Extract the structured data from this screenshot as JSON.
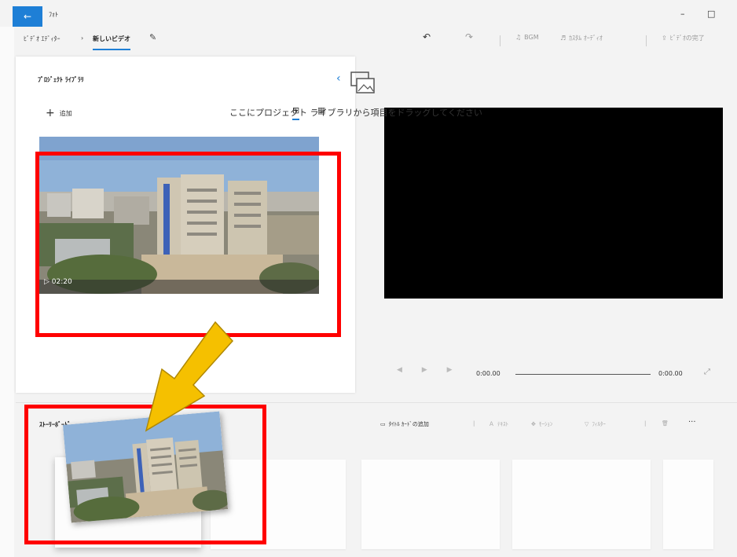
{
  "window": {
    "back_label": "←",
    "title": "ﾌｫﾄ",
    "minimize": "–",
    "maximize": "□"
  },
  "nav": {
    "breadcrumb_parent": "ﾋﾞﾃﾞｵ ｴﾃﾞｨﾀｰ",
    "breadcrumb_sep": "›",
    "breadcrumb_current": "新しいビデオ",
    "undo": "↶",
    "redo": "↷",
    "bgm": "BGM",
    "custom_audio": "ｶｽﾀﾑ ｵｰﾃﾞｨｵ",
    "finish_video": "ﾋﾞﾃﾞｵの完了"
  },
  "library": {
    "title": "ﾌﾟﾛｼﾞｪｸﾄ ﾗｲﾌﾞﾗﾘ",
    "add_label": "追加",
    "clip_duration": "02:20"
  },
  "player": {
    "current_time": "0:00.00",
    "total_time": "0:00.00"
  },
  "storyboard": {
    "title": "ｽﾄｰﾘｰﾎﾞｰﾄﾞ",
    "add_title_card": "ﾀｲﾄﾙ ｶｰﾄﾞの追加",
    "text": "ﾃｷｽﾄ",
    "motion": "ﾓｰｼｮﾝ",
    "filter": "ﾌｨﾙﾀｰ",
    "more": "···",
    "drop_hint": "ここにプロジェクト ライブラリから項目をドラッグしてください"
  },
  "colors": {
    "accent": "#1e7fd6",
    "annotation_red": "#ff0000",
    "arrow_yellow": "#f5c000"
  }
}
